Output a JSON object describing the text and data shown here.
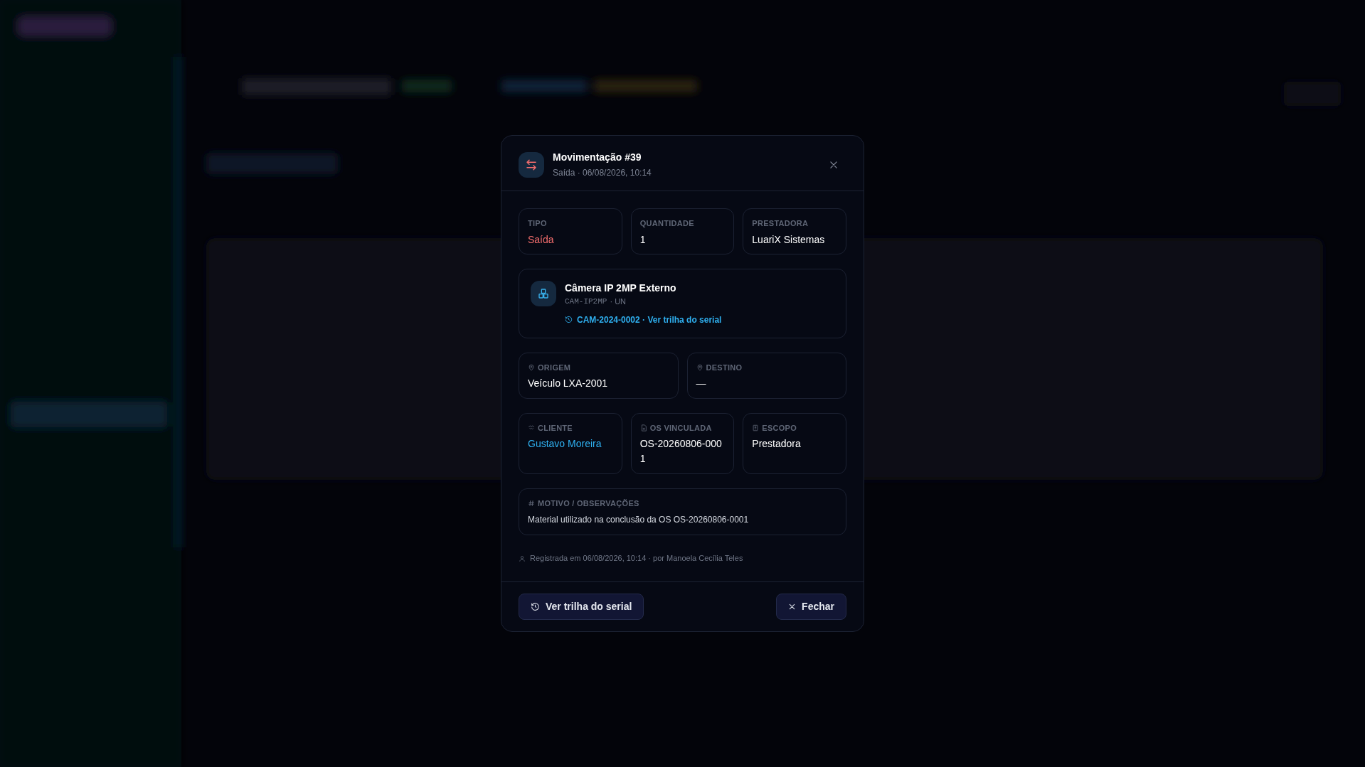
{
  "dialog": {
    "title": "Movimentação #39",
    "subtitle": "Saída · 06/08/2026, 10:14",
    "summary": [
      {
        "label": "TIPO",
        "value": "Saída",
        "kind": "danger"
      },
      {
        "label": "QUANTIDADE",
        "value": "1",
        "kind": "plain"
      },
      {
        "label": "PRESTADORA",
        "value": "LuariX Sistemas",
        "kind": "plain"
      }
    ],
    "product": {
      "name": "Câmera IP 2MP Externo",
      "code": "CAM-IP2MP",
      "unit": "· UN",
      "serial_link": "CAM-2024-0002 · Ver trilha do serial"
    },
    "locations": [
      {
        "label": "ORIGEM",
        "value": "Veículo LXA-2001"
      },
      {
        "label": "DESTINO",
        "value": "—"
      }
    ],
    "details": [
      {
        "label": "CLIENTE",
        "value": "Gustavo Moreira",
        "kind": "link"
      },
      {
        "label": "OS VINCULADA",
        "value": "OS-20260806-0001",
        "kind": "plain"
      },
      {
        "label": "ESCOPO",
        "value": "Prestadora",
        "kind": "plain"
      }
    ],
    "notes": {
      "label": "MOTIVO / OBSERVAÇÕES",
      "text": "Material utilizado na conclusão da OS OS-20260806-0001"
    },
    "registered": "Registrada em 06/08/2026, 10:14 · por Manoela Cecília Teles",
    "buttons": [
      {
        "label": "Ver trilha do serial",
        "kind": "history"
      },
      {
        "label": "Fechar",
        "kind": "close"
      }
    ]
  }
}
